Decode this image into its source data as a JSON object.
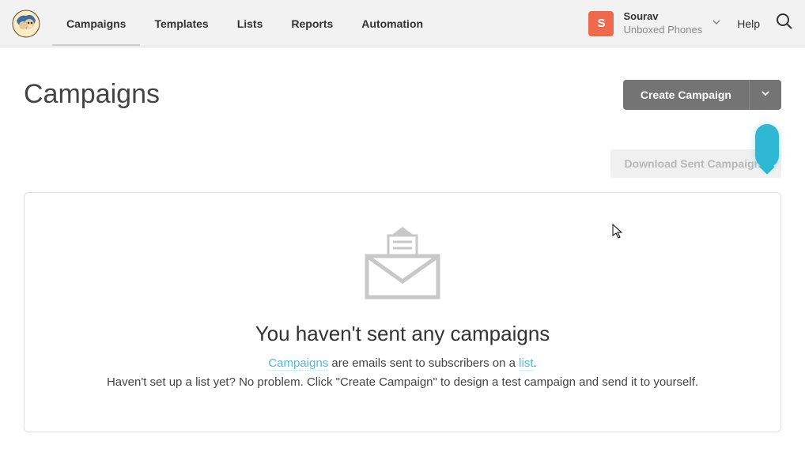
{
  "nav": {
    "items": [
      "Campaigns",
      "Templates",
      "Lists",
      "Reports",
      "Automation"
    ]
  },
  "account": {
    "avatar_letter": "S",
    "name": "Sourav",
    "org": "Unboxed Phones"
  },
  "help_label": "Help",
  "page": {
    "title": "Campaigns"
  },
  "buttons": {
    "create": "Create Campaign",
    "download": "Download Sent Campaigns"
  },
  "empty": {
    "title": "You haven't sent any campaigns",
    "link1": "Campaigns",
    "middle1": " are emails sent to subscribers on a ",
    "link2": "list",
    "line2": "Haven't set up a list yet? No problem. Click \"Create Campaign\" to design a test campaign and send it to yourself."
  }
}
